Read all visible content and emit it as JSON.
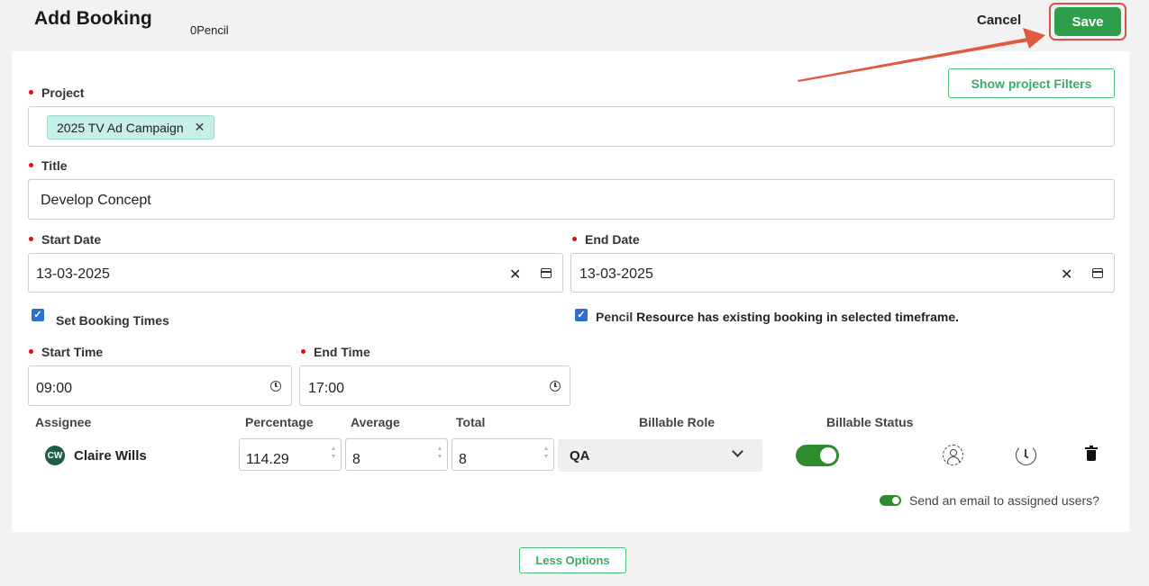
{
  "header": {
    "title": "Add Booking",
    "subtitle": "0Pencil",
    "cancel_label": "Cancel",
    "save_label": "Save"
  },
  "filters_button": "Show project Filters",
  "project": {
    "label": "Project",
    "chip": "2025 TV Ad Campaign",
    "chip_remove": "✕"
  },
  "title_field": {
    "label": "Title",
    "value": "Develop Concept"
  },
  "start_date": {
    "label": "Start Date",
    "value": "13-03-2025"
  },
  "end_date": {
    "label": "End Date",
    "value": "13-03-2025"
  },
  "clear_symbol": "✕",
  "set_booking_times": {
    "label": "Set Booking Times",
    "checked": true
  },
  "existing_booking": {
    "prefix": "Pencil",
    "label": "Resource has existing booking in selected timeframe.",
    "checked": true
  },
  "start_time": {
    "label": "Start Time",
    "value": "09:00"
  },
  "end_time": {
    "label": "End Time",
    "value": "17:00"
  },
  "assignee_table": {
    "headers": {
      "assignee": "Assignee",
      "percentage": "Percentage",
      "average": "Average",
      "total": "Total",
      "billable_role": "Billable Role",
      "billable_status": "Billable Status"
    },
    "row": {
      "initials": "CW",
      "name": "Claire Wills",
      "percentage": "114.29",
      "average": "8",
      "total": "8",
      "billable_role": "QA",
      "billable_status_on": true
    }
  },
  "email_toggle": {
    "label": "Send an email to assigned users?",
    "on": true
  },
  "less_options": "Less Options",
  "colors": {
    "save_green": "#2e9e4a",
    "outline_green": "#4cbf7a",
    "toggle_green": "#2e8b2e",
    "highlight_red": "#d9534a",
    "chip_bg": "#c6efe9",
    "checkbox_blue": "#2f6fcf"
  },
  "icons": [
    "close-icon",
    "calendar-icon",
    "clock-icon",
    "chevron-down-icon",
    "person-icon",
    "history-icon",
    "trash-icon"
  ]
}
